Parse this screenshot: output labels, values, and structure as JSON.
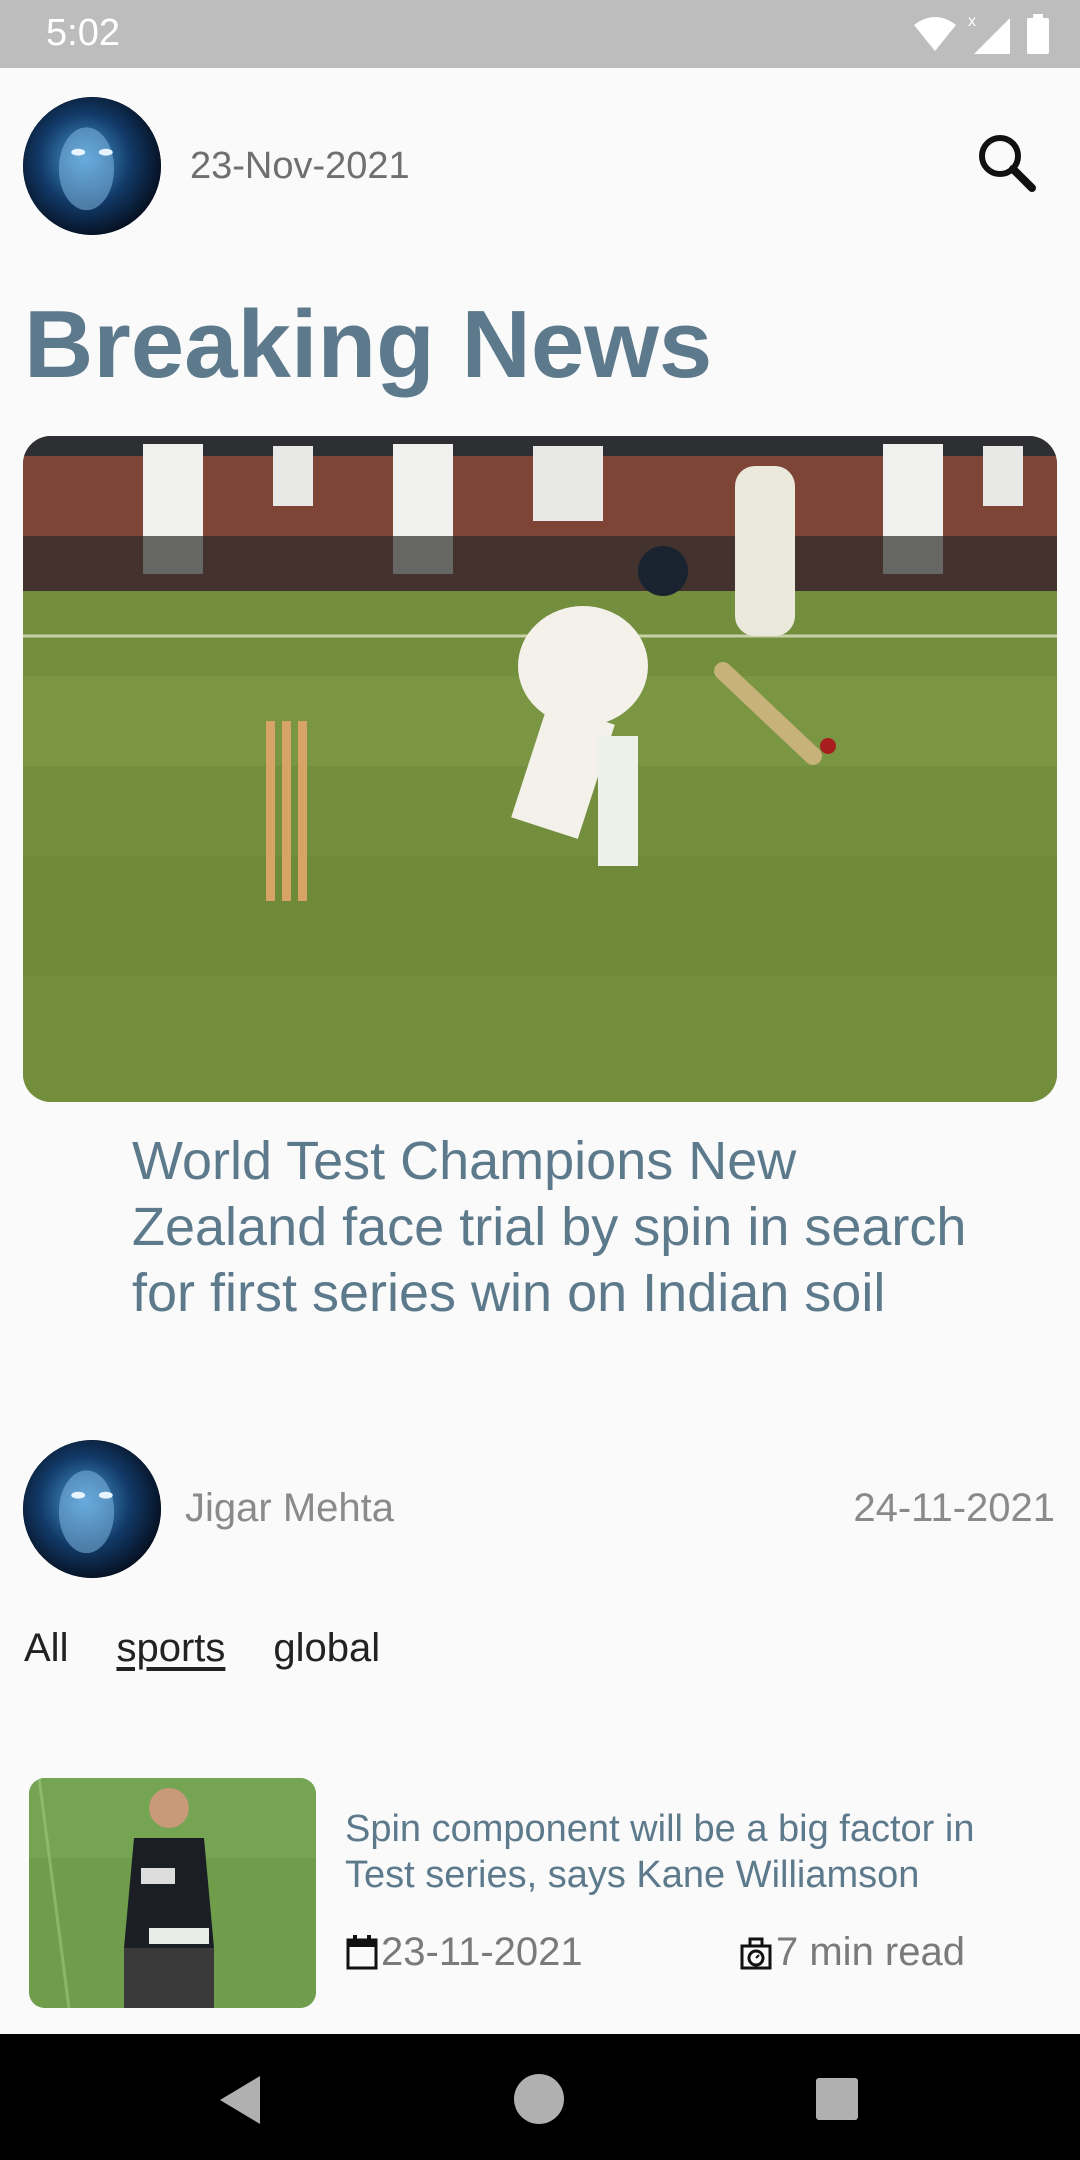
{
  "status_bar": {
    "time": "5:02",
    "icons": [
      "wifi-icon",
      "signal-icon",
      "battery-icon"
    ]
  },
  "header": {
    "date": "23-Nov-2021",
    "search_icon": "search-icon"
  },
  "page_title": "Breaking News",
  "featured": {
    "title": "World Test Champions New Zealand face trial by spin in search for first series win on Indian soil",
    "author": "Jigar Mehta",
    "date": "24-11-2021"
  },
  "tabs": [
    {
      "label": "All",
      "active": false
    },
    {
      "label": "sports",
      "active": true
    },
    {
      "label": "global",
      "active": false
    }
  ],
  "articles": [
    {
      "title": "Spin component will be a big factor in Test series, says Kane Williamson",
      "date": "23-11-2021",
      "read_time": "7 min read",
      "date_icon": "calendar-icon",
      "read_icon": "timer-icon"
    }
  ],
  "nav_bar": {
    "buttons": [
      "back-icon",
      "home-icon",
      "recents-icon"
    ]
  },
  "colors": {
    "accent": "#5d7a8c",
    "background": "#fafafa",
    "muted_text": "#8a8a8a",
    "status_bar": "#bdbdbd",
    "nav_bar": "#000000"
  }
}
